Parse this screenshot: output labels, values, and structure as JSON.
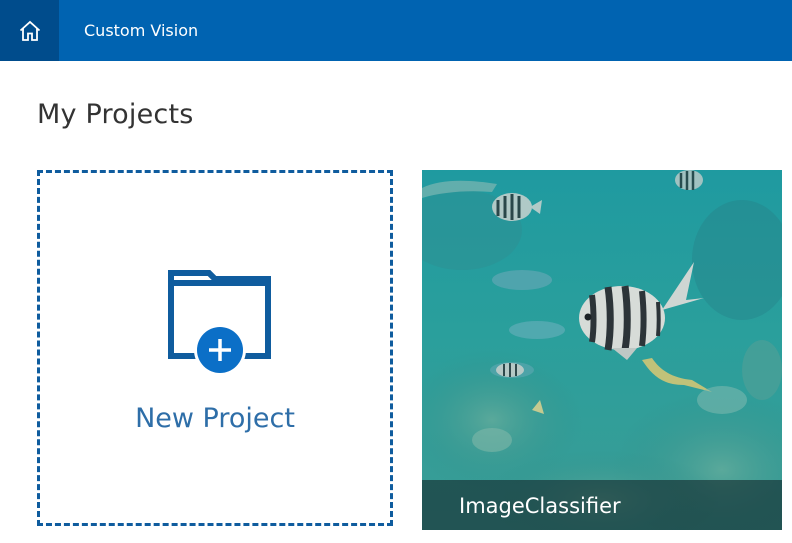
{
  "header": {
    "home_icon": "home-icon",
    "title": "Custom Vision"
  },
  "page": {
    "title": "My Projects"
  },
  "new_project": {
    "label": "New Project",
    "icon": "folder-add-icon"
  },
  "projects": [
    {
      "name": "ImageClassifier"
    }
  ],
  "colors": {
    "header_bg": "#0063b1",
    "home_bg": "#004c8c",
    "accent": "#0f5c9e",
    "plus_circle": "#0b6fc7"
  }
}
